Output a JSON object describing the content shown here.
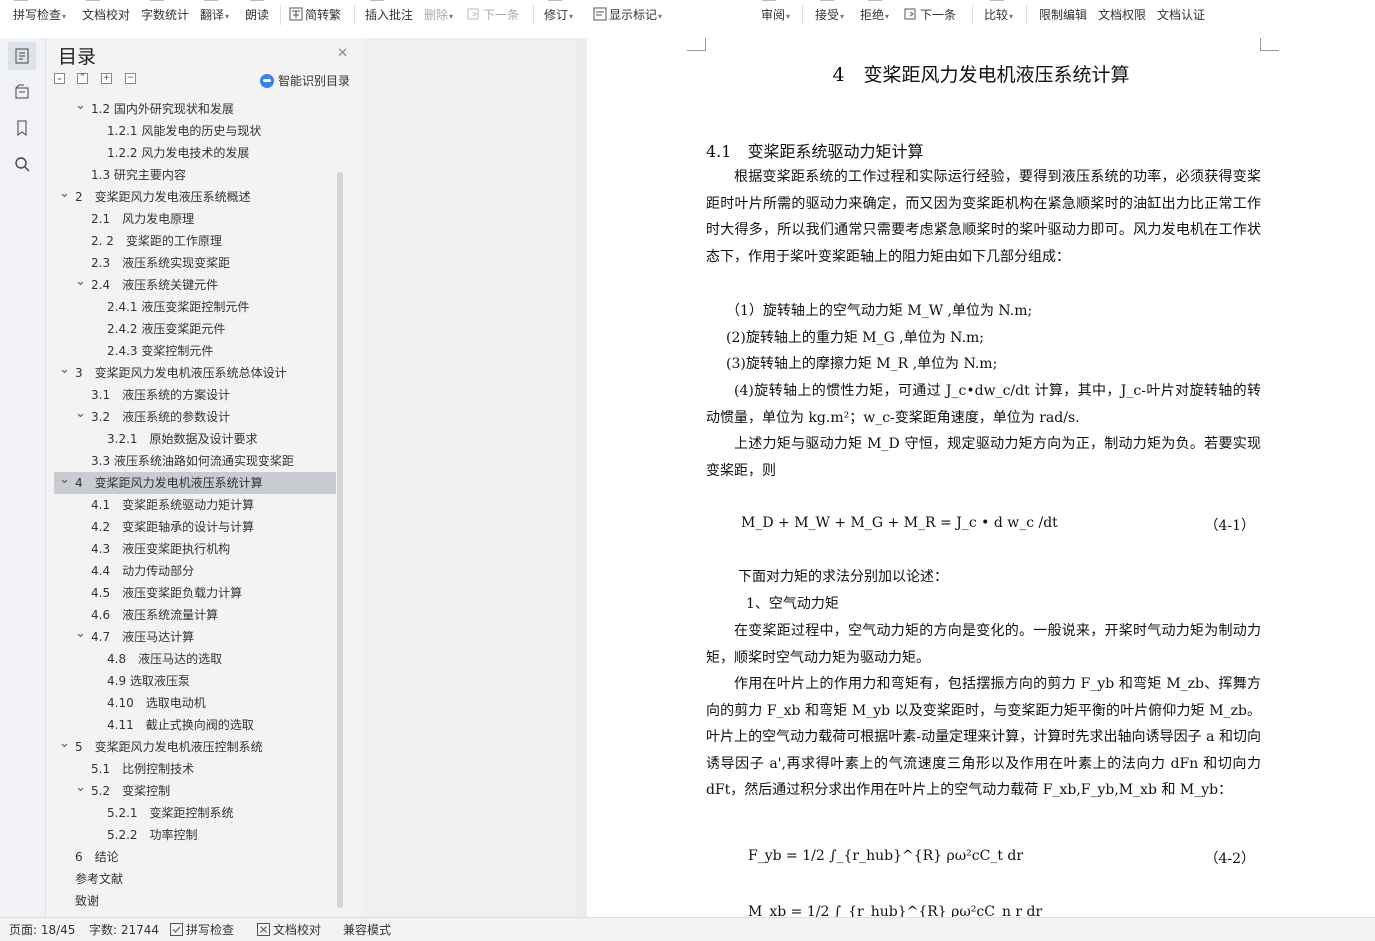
{
  "ribbon": {
    "left_items": [
      {
        "label": "拼写检查",
        "dropdown": true,
        "disabled": false
      },
      {
        "label": "文档校对",
        "dropdown": false,
        "disabled": false
      },
      {
        "label": "字数统计",
        "dropdown": false,
        "disabled": false
      },
      {
        "label": "翻译",
        "dropdown": true,
        "disabled": false
      },
      {
        "label": "朗读",
        "dropdown": false,
        "disabled": false
      },
      {
        "label": "简转繁",
        "dropdown": false,
        "disabled": false,
        "icon": "traditional-chinese-icon"
      },
      {
        "label": "插入批注",
        "dropdown": false,
        "disabled": false
      },
      {
        "label": "删除",
        "dropdown": true,
        "disabled": true
      },
      {
        "label": "下一条",
        "dropdown": false,
        "disabled": true,
        "icon": "next-comment-icon"
      },
      {
        "label": "修订",
        "dropdown": true,
        "disabled": false
      },
      {
        "label": "显示标记",
        "dropdown": true,
        "disabled": false,
        "icon": "show-markup-icon"
      }
    ],
    "right_items": [
      {
        "label": "审阅",
        "dropdown": true
      },
      {
        "label": "接受",
        "dropdown": true
      },
      {
        "label": "拒绝",
        "dropdown": true
      },
      {
        "label": "下一条",
        "dropdown": false,
        "icon": "next-revision-icon"
      },
      {
        "label": "比较",
        "dropdown": true
      },
      {
        "label": "限制编辑",
        "dropdown": false
      },
      {
        "label": "文档权限",
        "dropdown": false
      },
      {
        "label": "文档认证",
        "dropdown": false
      }
    ]
  },
  "sidebar_icons": [
    "toc-icon",
    "navigation-icon",
    "bookmark-icon",
    "search-icon"
  ],
  "panel": {
    "title": "目录",
    "smart_toc_label": "智能识别目录",
    "controls": [
      "collapse-all",
      "expand-all",
      "add-heading",
      "remove-heading"
    ]
  },
  "toc": [
    {
      "text": "1.2 国内外研究现状和发展",
      "level": 2,
      "expanded": true
    },
    {
      "text": "1.2.1 风能发电的历史与现状",
      "level": 3
    },
    {
      "text": "1.2.2 风力发电技术的发展",
      "level": 3
    },
    {
      "text": "1.3 研究主要内容",
      "level": 2
    },
    {
      "text": "2　变桨距风力发电液压系统概述",
      "level": 1,
      "expanded": true
    },
    {
      "text": "2.1　风力发电原理",
      "level": 2
    },
    {
      "text": "2. 2　变桨距的工作原理",
      "level": 2
    },
    {
      "text": "2.3　液压系统实现变桨距",
      "level": 2
    },
    {
      "text": "2.4　液压系统关键元件",
      "level": 2,
      "expanded": true
    },
    {
      "text": "2.4.1 液压变桨距控制元件",
      "level": 3
    },
    {
      "text": "2.4.2 液压变桨距元件",
      "level": 3
    },
    {
      "text": "2.4.3 变桨控制元件",
      "level": 3
    },
    {
      "text": "3　变桨距风力发电机液压系统总体设计",
      "level": 1,
      "expanded": true
    },
    {
      "text": "3.1　液压系统的方案设计",
      "level": 2
    },
    {
      "text": "3.2　液压系统的参数设计",
      "level": 2,
      "expanded": true
    },
    {
      "text": "3.2.1　原始数据及设计要求",
      "level": 3
    },
    {
      "text": "3.3 液压系统油路如何流通实现变桨距",
      "level": 2
    },
    {
      "text": "4　变桨距风力发电机液压系统计算",
      "level": 1,
      "expanded": true,
      "selected": true
    },
    {
      "text": "4.1　变桨距系统驱动力矩计算",
      "level": 2
    },
    {
      "text": "4.2　变桨距轴承的设计与计算",
      "level": 2
    },
    {
      "text": "4.3　液压变桨距执行机构",
      "level": 2
    },
    {
      "text": "4.4　动力传动部分",
      "level": 2
    },
    {
      "text": "4.5　液压变桨距负载力计算",
      "level": 2
    },
    {
      "text": "4.6　液压系统流量计算",
      "level": 2
    },
    {
      "text": "4.7　液压马达计算",
      "level": 2,
      "expanded": true
    },
    {
      "text": "4.8　液压马达的选取",
      "level": 3
    },
    {
      "text": "4.9 选取液压泵",
      "level": 3
    },
    {
      "text": "4.10　选取电动机",
      "level": 3
    },
    {
      "text": "4.11　截止式换向阀的选取",
      "level": 3
    },
    {
      "text": "5　变桨距风力发电机液压控制系统",
      "level": 1,
      "expanded": true
    },
    {
      "text": "5.1　比例控制技术",
      "level": 2
    },
    {
      "text": "5.2　变桨控制",
      "level": 2,
      "expanded": true
    },
    {
      "text": "5.2.1　变桨距控制系统",
      "level": 3
    },
    {
      "text": "5.2.2　功率控制",
      "level": 3
    },
    {
      "text": "6　结论",
      "level": 1
    },
    {
      "text": "参考文献",
      "level": 0
    },
    {
      "text": "致谢",
      "level": 0
    }
  ],
  "document": {
    "title": "4　变桨距风力发电机液压系统计算",
    "section_title": "4.1　变桨距系统驱动力矩计算",
    "para1": "根据变桨距系统的工作过程和实际运行经验，要得到液压系统的功率，必须获得变桨距时叶片所需的驱动力来确定，而又因为变桨距机构在紧急顺桨时的油缸出力比正常工作时大得多，所以我们通常只需要考虑紧急顺桨时的桨叶驱动力即可。风力发电机在工作状态下，作用于桨叶变桨距轴上的阻力矩由如下几部分组成：",
    "item1": "（1）旋转轴上的空气动力矩 M_W ,单位为 N.m;",
    "item2": "(2)旋转轴上的重力矩 M_G ,单位为 N.m;",
    "item3": "(3)旋转轴上的摩擦力矩 M_R ,单位为 N.m;",
    "item4": "(4)旋转轴上的惯性力矩，可通过 J_c•dw_c/dt 计算，其中，J_c-叶片对旋转轴的转动惯量，单位为 kg.m²；w_c-变桨距角速度，单位为 rad/s.",
    "para2": "上述力矩与驱动力矩 M_D 守恒，规定驱动力矩方向为正，制动力矩为负。若要实现变桨距，则",
    "eq1": "M_D + M_W + M_G + M_R = J_c • d w_c /dt",
    "eq1_num": "（4-1）",
    "para3": "下面对力矩的求法分别加以论述：",
    "sub1": "1、空气动力矩",
    "para4": "在变桨距过程中，空气动力矩的方向是变化的。一般说来，开桨时气动力矩为制动力矩，顺桨时空气动力矩为驱动力矩。",
    "para5": "作用在叶片上的作用力和弯矩有，包括摆振方向的剪力 F_yb 和弯矩 M_zb、挥舞方向的剪力 F_xb 和弯矩 M_yb 以及变桨距时，与变桨距力矩平衡的叶片俯仰力矩 M_zb。叶片上的空气动力载荷可根据叶素-动量定理来计算，计算时先求出轴向诱导因子 a 和切向诱导因子 a',再求得叶素上的气流速度三角形以及作用在叶素上的法向力 dFn 和切向力 dFt，然后通过积分求出作用在叶片上的空气动力载荷 F_xb,F_yb,M_xb 和 M_yb：",
    "eq2": "F_yb = 1/2 ∫_{r_hub}^{R} ρω²cC_t dr",
    "eq2_num": "（4-2）",
    "eq3_partial": "M_xb = 1/2 ∫_{r_hub}^{R} ρω²cC_n r dr"
  },
  "statusbar": {
    "page": "页面: 18/45",
    "words": "字数: 21744",
    "spell": "拼写检查",
    "proof": "文档校对",
    "compat": "兼容模式"
  }
}
